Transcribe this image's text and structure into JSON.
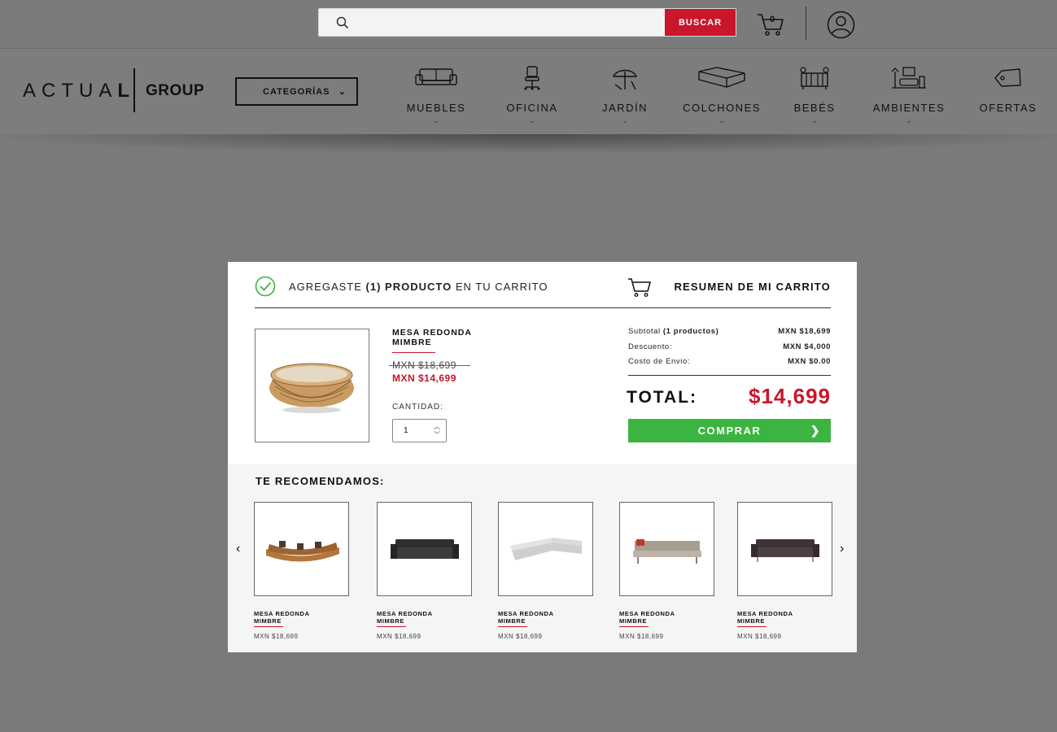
{
  "search": {
    "placeholder": "",
    "button_label": "BUSCAR"
  },
  "header": {
    "cart_count": "0",
    "logo_main": "ACTUAL",
    "logo_group": "GROUP",
    "categories_label": "CATEGORÍAS"
  },
  "nav": {
    "items": [
      {
        "label": "MUEBLES",
        "icon": "sofa-icon",
        "caret": "⌄"
      },
      {
        "label": "OFICINA",
        "icon": "office-chair-icon",
        "caret": "⌄"
      },
      {
        "label": "JARDÍN",
        "icon": "garden-umbrella-icon",
        "caret": "⌄"
      },
      {
        "label": "COLCHONES",
        "icon": "mattress-icon",
        "caret": "⌄"
      },
      {
        "label": "BEBÉS",
        "icon": "crib-icon",
        "caret": "⌄"
      },
      {
        "label": "AMBIENTES",
        "icon": "room-icon",
        "caret": "⌄"
      },
      {
        "label": "OFERTAS",
        "icon": "tag-icon"
      }
    ]
  },
  "modal": {
    "added_prefix": "AGREGASTE",
    "added_count": "(1) PRODUCTO",
    "added_suffix": "EN TU CARRITO",
    "summary_title": "RESUMEN DE MI CARRITO",
    "product": {
      "name": "MESA REDONDA MIMBRE",
      "old_price": "MXN $18,699",
      "new_price": "MXN $14,699",
      "quantity_label": "CANTIDAD:",
      "quantity": "1"
    },
    "summary": {
      "subtotal_label": "Subtotal",
      "subtotal_count": "(1 productos)",
      "subtotal_value": "MXN $18,699",
      "discount_label": "Descuento:",
      "discount_value": "MXN $4,000",
      "shipping_label": "Costo de Envio:",
      "shipping_value": "MXN $0.00",
      "total_label": "TOTAL:",
      "total_value": "$14,699",
      "buy_label": "COMPRAR"
    },
    "recommendations": {
      "title": "TE RECOMENDAMOS:",
      "items": [
        {
          "name": "MESA REDONDA MIMBRE",
          "price": "MXN $18,699"
        },
        {
          "name": "MESA REDONDA MIMBRE",
          "price": "MXN $18,699"
        },
        {
          "name": "MESA REDONDA MIMBRE",
          "price": "MXN $18,699"
        },
        {
          "name": "MESA REDONDA MIMBRE",
          "price": "MXN $18,699"
        },
        {
          "name": "MESA REDONDA MIMBRE",
          "price": "MXN $18,699"
        }
      ]
    }
  },
  "colors": {
    "accent_red": "#c9162b",
    "buy_green": "#3cb441",
    "overlay_gray": "#7a7a7a"
  }
}
